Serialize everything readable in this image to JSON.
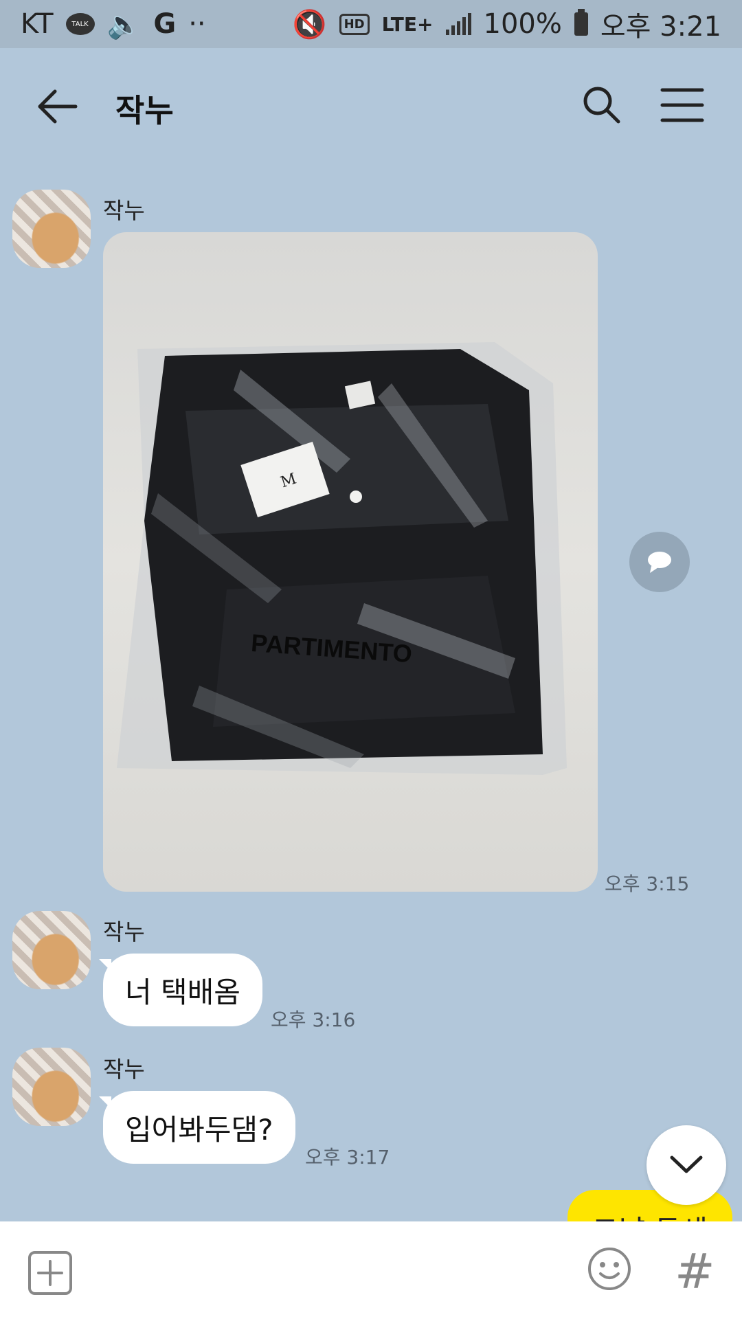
{
  "status_bar": {
    "carrier": "KT",
    "talk_badge": "TALK",
    "network_g": "G",
    "dots": "··",
    "hd": "HD",
    "lte": "LTE+",
    "battery": "100%",
    "time": "오후 3:21"
  },
  "header": {
    "title": "작누"
  },
  "messages": [
    {
      "sender": "작누",
      "type": "image",
      "image_text": "PARTIMENTO",
      "tag_size": "M",
      "time": "오후 3:15"
    },
    {
      "sender": "작누",
      "type": "text",
      "text": "너 택배옴",
      "time": "오후 3:16"
    },
    {
      "sender": "작누",
      "type": "text",
      "text": "입어봐두댐?",
      "time": "오후 3:17"
    }
  ],
  "my_message_partial": "그냥 두세",
  "colors": {
    "chat_background": "#b2c7da",
    "my_bubble": "#fee500",
    "other_bubble": "#ffffff"
  },
  "icons": [
    "back-arrow-icon",
    "search-icon",
    "hamburger-menu-icon",
    "share-bubble-icon",
    "chevron-down-icon",
    "plus-square-icon",
    "emoji-icon",
    "hash-icon"
  ]
}
